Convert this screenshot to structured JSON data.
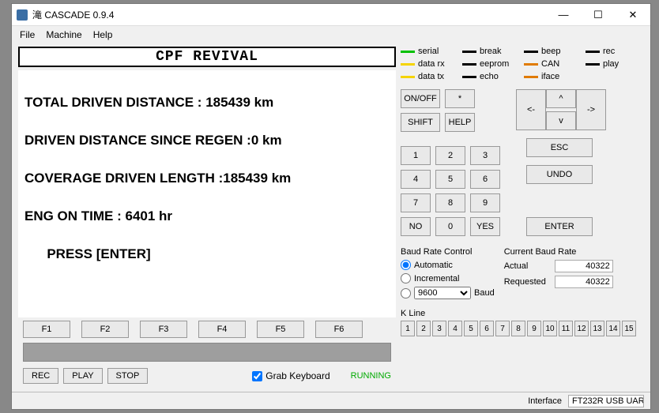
{
  "window": {
    "title": "滝 CASCADE 0.9.4",
    "min": "—",
    "max": "☐",
    "close": "✕"
  },
  "menu": {
    "file": "File",
    "machine": "Machine",
    "help": "Help"
  },
  "banner": "CPF REVIVAL",
  "terminal": {
    "l1": "TOTAL DRIVEN DISTANCE : 185439 km",
    "l2": "DRIVEN DISTANCE SINCE REGEN :0 km",
    "l3": "COVERAGE DRIVEN LENGTH :185439 km",
    "l4": "ENG ON TIME : 6401 hr",
    "l5": "      PRESS [ENTER]"
  },
  "fkeys": {
    "f1": "F1",
    "f2": "F2",
    "f3": "F3",
    "f4": "F4",
    "f5": "F5",
    "f6": "F6"
  },
  "controls": {
    "rec": "REC",
    "play": "PLAY",
    "stop": "STOP",
    "grab": "Grab Keyboard",
    "status": "RUNNING"
  },
  "legend": {
    "serial": {
      "label": "serial",
      "color": "#00c000"
    },
    "break": {
      "label": "break",
      "color": "#000000"
    },
    "beep": {
      "label": "beep",
      "color": "#000000"
    },
    "rec": {
      "label": "rec",
      "color": "#000000"
    },
    "datarx": {
      "label": "data rx",
      "color": "#f5d400"
    },
    "eeprom": {
      "label": "eeprom",
      "color": "#000000"
    },
    "can": {
      "label": "CAN",
      "color": "#e07b00"
    },
    "play": {
      "label": "play",
      "color": "#000000"
    },
    "datatx": {
      "label": "data tx",
      "color": "#f5d400"
    },
    "echo": {
      "label": "echo",
      "color": "#000000"
    },
    "iface": {
      "label": "iface",
      "color": "#e07b00"
    }
  },
  "keypad": {
    "onoff": "ON/OFF",
    "star": "*",
    "shift": "SHIFT",
    "help": "HELP",
    "k1": "1",
    "k2": "2",
    "k3": "3",
    "k4": "4",
    "k5": "5",
    "k6": "6",
    "k7": "7",
    "k8": "8",
    "k9": "9",
    "no": "NO",
    "k0": "0",
    "yes": "YES",
    "left": "<-",
    "up": "^",
    "down": "v",
    "right": "->",
    "esc": "ESC",
    "undo": "UNDO",
    "enter": "ENTER"
  },
  "baud": {
    "ctrl_label": "Baud Rate Control",
    "auto": "Automatic",
    "incr": "Incremental",
    "selected": "9600",
    "unit": "Baud",
    "cur_label": "Current Baud Rate",
    "actual_label": "Actual",
    "actual": "40322",
    "req_label": "Requested",
    "req": "40322"
  },
  "kline": {
    "label": "K Line",
    "b": [
      "1",
      "2",
      "3",
      "4",
      "5",
      "6",
      "7",
      "8",
      "9",
      "10",
      "11",
      "12",
      "13",
      "14",
      "15"
    ]
  },
  "footer": {
    "iface_label": "Interface",
    "iface": "FT232R USB UAR"
  }
}
